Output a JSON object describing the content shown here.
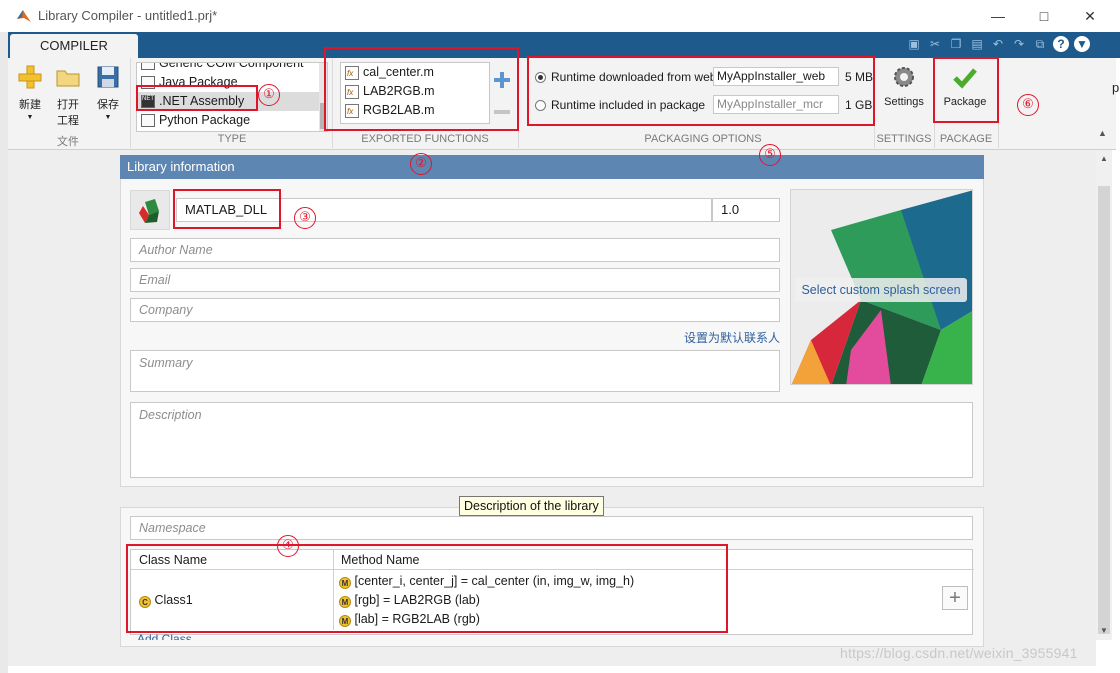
{
  "window": {
    "title": "Library Compiler - untitled1.prj*"
  },
  "tab": {
    "label": "COMPILER"
  },
  "file_section": {
    "label": "文件",
    "new_label": "新建",
    "open_label": "打开\n工程",
    "open_line1": "打开",
    "open_line2": "工程",
    "save_label": "保存"
  },
  "type_section": {
    "label": "TYPE",
    "items": [
      {
        "label": "Generic COM Component"
      },
      {
        "label": "Java Package"
      },
      {
        "label": ".NET Assembly",
        "selected": true
      },
      {
        "label": "Python Package"
      }
    ]
  },
  "functions_section": {
    "label": "EXPORTED FUNCTIONS",
    "items": [
      "cal_center.m",
      "LAB2RGB.m",
      "RGB2LAB.m"
    ]
  },
  "packaging_section": {
    "label": "PACKAGING OPTIONS",
    "web": {
      "label": "Runtime downloaded from web",
      "value": "MyAppInstaller_web",
      "size": "5 MB",
      "selected": true
    },
    "included": {
      "label": "Runtime included in package",
      "value": "MyAppInstaller_mcr",
      "size": "1 GB",
      "selected": false
    }
  },
  "settings_section": {
    "label": "SETTINGS",
    "button": "Settings"
  },
  "package_section": {
    "label": "PACKAGE",
    "button": "Package"
  },
  "library_info": {
    "header": "Library information",
    "name": "MATLAB_DLL",
    "version": "1.0",
    "author_placeholder": "Author Name",
    "email_placeholder": "Email",
    "company_placeholder": "Company",
    "set_default_contact": "设置为默认联系人",
    "summary_placeholder": "Summary",
    "description_placeholder": "Description",
    "splash_label": "Select custom splash screen",
    "tooltip": "Description of the library"
  },
  "class_info": {
    "namespace_placeholder": "Namespace",
    "col_class": "Class Name",
    "col_method": "Method Name",
    "class_name": "Class1",
    "methods": [
      "[center_i, center_j] = cal_center (in, img_w, img_h)",
      "[rgb] = LAB2RGB (lab)",
      "[lab] = RGB2LAB (rgb)"
    ],
    "add_class": "Add Class"
  },
  "annotations": [
    "①",
    "②",
    "③",
    "④",
    "⑤",
    "⑥"
  ],
  "watermark": "https://blog.csdn.net/weixin_3955941",
  "edge_fragment": "p",
  "colors": {
    "tab_bar": "#1f5a8c",
    "panel_header": "#5e86b2",
    "annotation_red": "#e0152a",
    "link": "#2e5f9c"
  }
}
